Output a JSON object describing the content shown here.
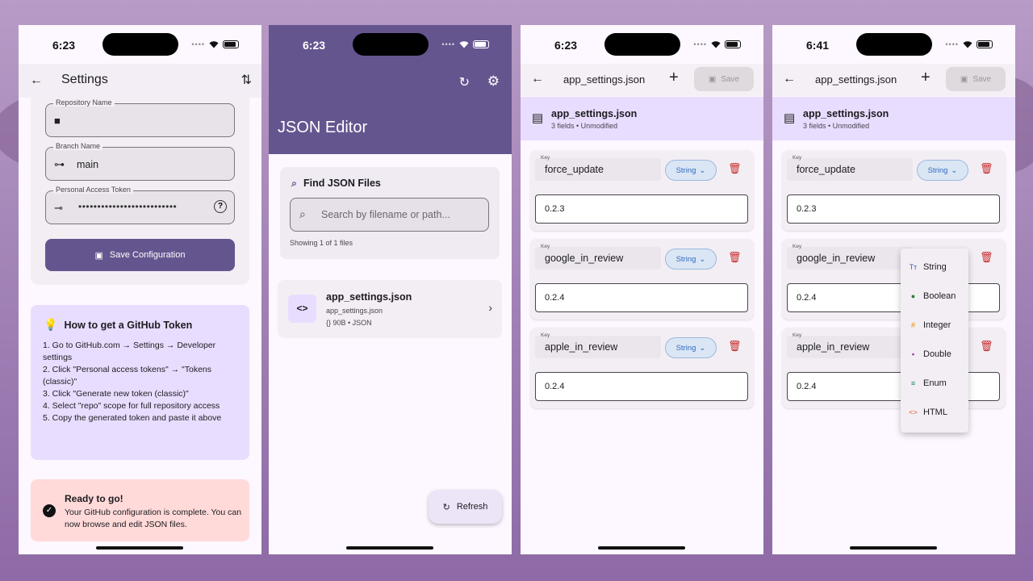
{
  "status": {
    "time_1": "6:23",
    "time_2": "6:23",
    "time_3": "6:23",
    "time_4": "6:41"
  },
  "settings": {
    "title": "Settings",
    "repo_label": "Repository Name",
    "repo_value": "",
    "branch_label": "Branch Name",
    "branch_value": "main",
    "token_label": "Personal Access Token",
    "token_value": "••••••••••••••••••••••••••",
    "save_label": "Save Configuration",
    "how_title": "How to get a GitHub Token",
    "steps": [
      "1. Go to GitHub.com → Settings → Developer settings",
      "2. Click \"Personal access tokens\" → \"Tokens (classic)\"",
      "3. Click \"Generate new token (classic)\"",
      "4. Select \"repo\" scope for full repository access",
      "5. Copy the generated token and paste it above"
    ],
    "ready_title": "Ready to go!",
    "ready_desc": "Your GitHub configuration is complete. You can now browse and edit JSON files."
  },
  "editor_home": {
    "title": "JSON Editor",
    "find_title": "Find JSON Files",
    "search_placeholder": "Search by filename or path...",
    "count_text": "Showing 1 of 1 files",
    "file": {
      "name": "app_settings.json",
      "path": "app_settings.json",
      "meta": "90B • JSON",
      "icon": "<>"
    },
    "fab_label": "Refresh"
  },
  "file_editor": {
    "title": "app_settings.json",
    "save_label": "Save",
    "file_name": "app_settings.json",
    "file_meta": "3 fields • Unmodified",
    "key_label": "Key",
    "entries": [
      {
        "key": "force_update",
        "type": "String",
        "value": "0.2.3"
      },
      {
        "key": "google_in_review",
        "type": "String",
        "value": "0.2.4"
      },
      {
        "key": "apple_in_review",
        "type": "String",
        "value": "0.2.4"
      }
    ]
  },
  "type_menu": {
    "items": [
      {
        "label": "String",
        "icon": "Tт",
        "color": "#2f6bbd"
      },
      {
        "label": "Boolean",
        "icon": "●",
        "color": "#2e7d32"
      },
      {
        "label": "Integer",
        "icon": "#",
        "color": "#e08a00"
      },
      {
        "label": "Double",
        "icon": "▪",
        "color": "#8e24aa"
      },
      {
        "label": "Enum",
        "icon": "≡",
        "color": "#00897b"
      },
      {
        "label": "HTML",
        "icon": "<>",
        "color": "#e05a2b"
      }
    ]
  }
}
